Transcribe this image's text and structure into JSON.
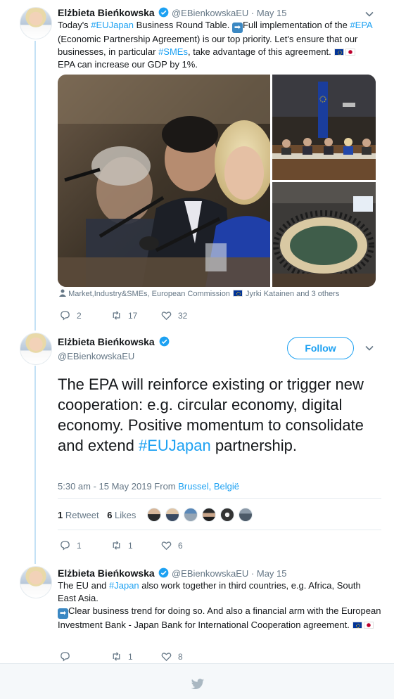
{
  "tweet1": {
    "name": "Elżbieta Bieńkowska",
    "handle": "@EBienkowskaEU",
    "dot": "·",
    "date": "May 15",
    "text_1": "Today's ",
    "hashtag_eujapan": "#EUJapan",
    "text_2": " Business Round Table. ",
    "text_3": "Full implementation of the ",
    "hashtag_epa": "#EPA",
    "text_4": " (Economic Partnership Agreement) is our top priority. Let's ensure that our businesses, in particular ",
    "hashtag_smes": "#SMEs",
    "text_5": ", take advantage of this agreement. ",
    "text_6": "EPA can increase our GDP by 1%.",
    "tags_line_1": "Market,Industry&SMEs, European Commission ",
    "tags_line_2": " Jyrki Katainen and 3 others",
    "reply_count": "2",
    "retweet_count": "17",
    "like_count": "32"
  },
  "tweet2": {
    "name": "Elżbieta Bieńkowska",
    "handle": "@EBienkowskaEU",
    "follow_label": "Follow",
    "text_main": "The EPA will reinforce existing or trigger new cooperation: e.g. circular economy, digital economy. Positive momentum to consolidate and extend ",
    "hashtag": "#EUJapan",
    "text_end": " partnership.",
    "timestamp": "5:30 am - 15 May 2019 From ",
    "location": "Brussel, België",
    "retweets_num": "1",
    "retweets_label": "Retweet",
    "likes_num": "6",
    "likes_label": "Likes",
    "reply_count": "1",
    "retweet_count": "1",
    "like_count": "6"
  },
  "tweet3": {
    "name": "Elżbieta Bieńkowska",
    "handle": "@EBienkowskaEU",
    "dot": "·",
    "date": "May 15",
    "text_1": "The EU and ",
    "hashtag_japan": "#Japan",
    "text_2": " also work together in third countries, e.g. Africa, South East Asia.",
    "text_3": "Clear business trend for doing so. And also a financial arm with the European Investment Bank - Japan Bank for International Cooperation agreement. ",
    "retweet_count": "1",
    "like_count": "8"
  },
  "icons": {
    "reply": "reply-icon",
    "retweet": "retweet-icon",
    "like": "heart-icon",
    "verified": "verified-badge-icon",
    "caret": "chevron-down-icon",
    "person": "person-icon",
    "twitter": "twitter-bird-icon"
  },
  "colors": {
    "accent": "#1da1f2",
    "muted": "#657786",
    "thread": "#c4e1f5"
  }
}
